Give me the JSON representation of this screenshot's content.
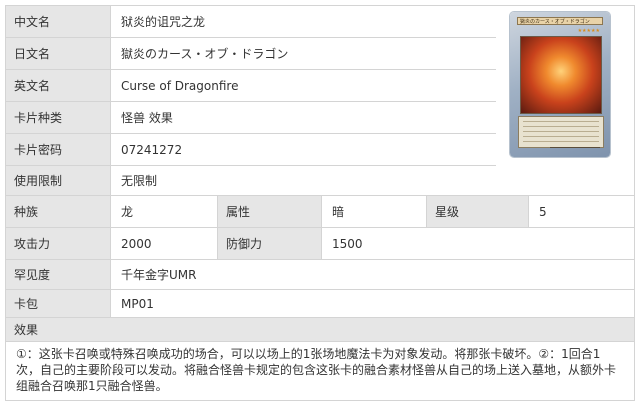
{
  "rows": {
    "cn_name": {
      "label": "中文名",
      "value": "狱炎的诅咒之龙"
    },
    "jp_name": {
      "label": "日文名",
      "value": "獄炎のカース・オブ・ドラゴン"
    },
    "en_name": {
      "label": "英文名",
      "value": "Curse of Dragonfire"
    },
    "card_type": {
      "label": "卡片种类",
      "value": "怪兽 效果"
    },
    "password": {
      "label": "卡片密码",
      "value": "07241272"
    },
    "limit": {
      "label": "使用限制",
      "value": "无限制"
    },
    "race_row": {
      "race_label": "种族",
      "race_value": "龙",
      "attr_label": "属性",
      "attr_value": "暗",
      "level_label": "星级",
      "level_value": "5"
    },
    "atk_row": {
      "atk_label": "攻击力",
      "atk_value": "2000",
      "def_label": "防御力",
      "def_value": "1500"
    },
    "rarity": {
      "label": "罕见度",
      "value": "千年金字UMR"
    },
    "pack": {
      "label": "卡包",
      "value": "MP01"
    },
    "effect": {
      "label": "效果",
      "text": "①：这张卡召唤或特殊召唤成功的场合，可以以场上的1张场地魔法卡为对象发动。将那张卡破坏。②：1回合1次，自己的主要阶段可以发动。将融合怪兽卡规定的包含这张卡的融合素材怪兽从自己的场上送入墓地，从额外卡组融合召唤那1只融合怪兽。"
    }
  },
  "card_image": {
    "name_text": "獄炎のカース・オブ・ドラゴン",
    "stars": "★★★★★"
  },
  "colors": {
    "label_bg": "#e6e6e6",
    "border": "#d4d4d4",
    "text": "#333333"
  }
}
